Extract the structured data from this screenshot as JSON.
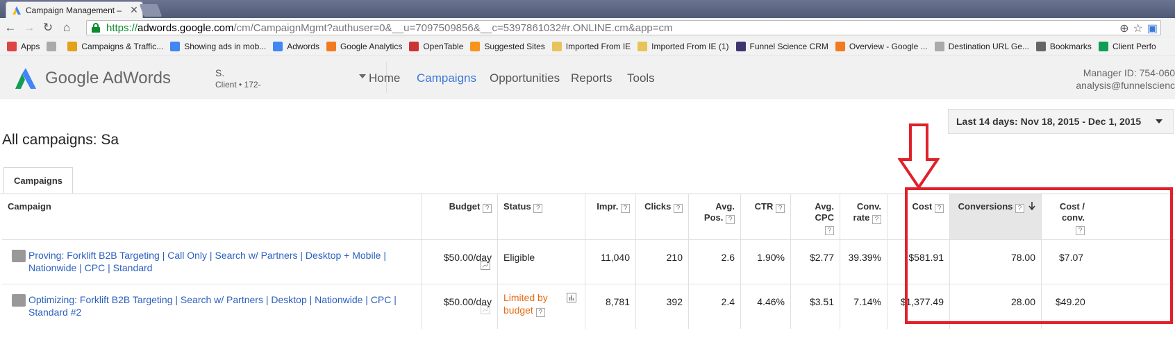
{
  "browser": {
    "tab_title": "Campaign Management –",
    "url_scheme": "https://",
    "url_host": "adwords.google.com",
    "url_path": "/cm/CampaignMgmt?authuser=0&__u=7097509856&__c=5397861032#r.ONLINE.cm&app=cm"
  },
  "bookmarks": [
    {
      "label": "Apps",
      "icon": "apps-grid-icon",
      "color": "#d44"
    },
    {
      "label": "",
      "icon": "page-icon",
      "color": "#aaa"
    },
    {
      "label": "Campaigns & Traffic...",
      "icon": "colorful-icon",
      "color": "#e3a21a"
    },
    {
      "label": "Showing ads in mob...",
      "icon": "google-g-icon",
      "color": "#4285f4"
    },
    {
      "label": "Adwords",
      "icon": "google-g-icon",
      "color": "#4285f4"
    },
    {
      "label": "Google Analytics",
      "icon": "analytics-icon",
      "color": "#f27b20"
    },
    {
      "label": "OpenTable",
      "icon": "opentable-icon",
      "color": "#c33"
    },
    {
      "label": "Suggested Sites",
      "icon": "suggested-icon",
      "color": "#f7941d"
    },
    {
      "label": "Imported From IE",
      "icon": "folder-icon",
      "color": "#e8c35a"
    },
    {
      "label": "Imported From IE (1)",
      "icon": "folder-icon",
      "color": "#e8c35a"
    },
    {
      "label": "Funnel Science CRM",
      "icon": "b-icon",
      "color": "#3c3570"
    },
    {
      "label": "Overview - Google ...",
      "icon": "analytics-icon",
      "color": "#f27b20"
    },
    {
      "label": "Destination URL Ge...",
      "icon": "page-icon",
      "color": "#aaa"
    },
    {
      "label": "Bookmarks",
      "icon": "star-icon",
      "color": "#666"
    },
    {
      "label": "Client Perfo",
      "icon": "sheets-icon",
      "color": "#0f9d58"
    }
  ],
  "header": {
    "wordmark": "Google AdWords",
    "account_name": "S.",
    "account_client": "Client  •  172-",
    "nav": [
      "Home",
      "Campaigns",
      "Opportunities",
      "Reports",
      "Tools"
    ],
    "active_nav": "Campaigns",
    "manager_id": "Manager ID: 754-060",
    "manager_email": "analysis@funnelscienc"
  },
  "date_range": "Last 14 days: Nov 18, 2015 - Dec 1, 2015",
  "page_title": "All campaigns: Sa",
  "tab_label": "Campaigns",
  "table": {
    "headers": {
      "campaign": "Campaign",
      "budget": "Budget",
      "status": "Status",
      "impr": "Impr.",
      "clicks": "Clicks",
      "avgpos_1": "Avg.",
      "avgpos_2": "Pos.",
      "ctr": "CTR",
      "avgcpc_1": "Avg.",
      "avgcpc_2": "CPC",
      "convrate_1": "Conv.",
      "convrate_2": "rate",
      "cost": "Cost",
      "conversions": "Conversions",
      "costconv_1": "Cost /",
      "costconv_2": "conv."
    },
    "rows": [
      {
        "campaign": "Proving: Forklift B2B Targeting | Call Only | Search w/ Partners | Desktop + Mobile | Nationwide | CPC | Standard",
        "budget": "$50.00/day",
        "status": "Eligible",
        "impr": "11,040",
        "clicks": "210",
        "avgpos": "2.6",
        "ctr": "1.90%",
        "avgcpc": "$2.77",
        "convrate": "39.39%",
        "cost": "$581.91",
        "conversions": "78.00",
        "costconv": "$7.07"
      },
      {
        "campaign": "Optimizing: Forklift B2B Targeting | Search w/ Partners | Desktop | Nationwide | CPC | Standard #2",
        "budget": "$50.00/day",
        "status_1": "Limited by",
        "status_2": "budget",
        "impr": "8,781",
        "clicks": "392",
        "avgpos": "2.4",
        "ctr": "4.46%",
        "avgcpc": "$3.51",
        "convrate": "7.14%",
        "cost": "$1,377.49",
        "conversions": "28.00",
        "costconv": "$49.20"
      }
    ]
  },
  "colors": {
    "link": "#2a5fbf",
    "active_nav": "#3b78d6",
    "limited_status": "#e66a11",
    "annotation": "#e0202a"
  }
}
